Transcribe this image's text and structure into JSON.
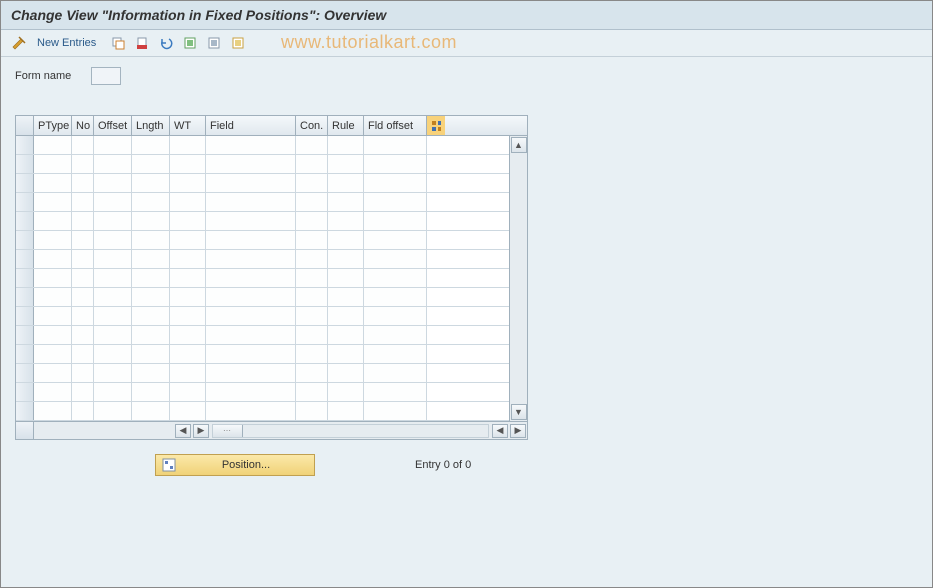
{
  "title": "Change View \"Information in Fixed Positions\": Overview",
  "toolbar": {
    "new_entries_label": "New Entries"
  },
  "watermark": "www.tutorialkart.com",
  "form": {
    "name_label": "Form name",
    "name_value": ""
  },
  "table": {
    "columns": [
      {
        "label": "PType",
        "width": 38
      },
      {
        "label": "No",
        "width": 22
      },
      {
        "label": "Offset",
        "width": 38
      },
      {
        "label": "Lngth",
        "width": 38
      },
      {
        "label": "WT",
        "width": 36
      },
      {
        "label": "Field",
        "width": 90
      },
      {
        "label": "Con.",
        "width": 32
      },
      {
        "label": "Rule",
        "width": 36
      },
      {
        "label": "Fld offset",
        "width": 63
      }
    ],
    "row_count": 15
  },
  "footer": {
    "position_label": "Position...",
    "entry_label": "Entry 0 of 0"
  }
}
